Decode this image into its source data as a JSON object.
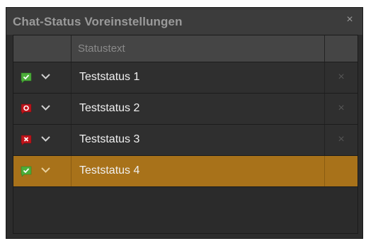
{
  "dialog": {
    "title": "Chat-Status Voreinstellungen",
    "close_glyph": "×"
  },
  "table": {
    "header": {
      "icon_col": "",
      "text_col": "Statustext",
      "action_col": ""
    },
    "rows": [
      {
        "status_icon": "green-check-flag-icon",
        "text": "Teststatus 1",
        "delete_glyph": "×",
        "selected": false
      },
      {
        "status_icon": "red-circle-flag-icon",
        "text": "Teststatus 2",
        "delete_glyph": "×",
        "selected": false
      },
      {
        "status_icon": "red-x-flag-icon",
        "text": "Teststatus 3",
        "delete_glyph": "×",
        "selected": false
      },
      {
        "status_icon": "green-check-flag-icon",
        "text": "Teststatus 4",
        "delete_glyph": "",
        "selected": true
      }
    ]
  },
  "colors": {
    "selected_row": "#a8721a",
    "green": "#4cae3a",
    "red": "#c0141b"
  }
}
